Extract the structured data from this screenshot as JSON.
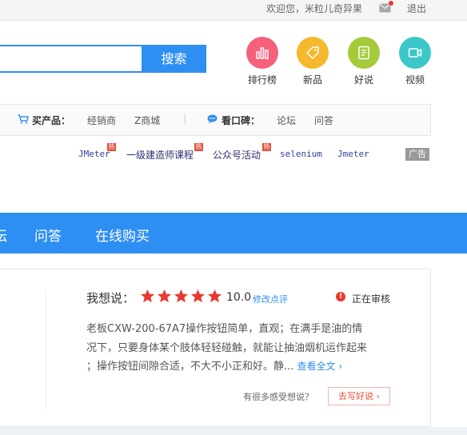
{
  "topbar": {
    "welcome": "欢迎您，米粒儿奇异果",
    "logout": "退出"
  },
  "search": {
    "value": "",
    "button": "搜索"
  },
  "nav_icons": [
    {
      "label": "排行榜",
      "icon": "bar-chart-icon",
      "color": "#f5617b"
    },
    {
      "label": "新品",
      "icon": "tag-icon",
      "color": "#f5b82e"
    },
    {
      "label": "好说",
      "icon": "note-icon",
      "color": "#a5cb3b"
    },
    {
      "label": "视频",
      "icon": "video-icon",
      "color": "#3cc8c8"
    }
  ],
  "products_bar": {
    "buy_label": "买产品：",
    "buy_links": [
      "经销商",
      "Z商城"
    ],
    "reputation_label": "看口碑：",
    "reputation_links": [
      "论坛",
      "问答"
    ]
  },
  "hot_keywords": [
    {
      "text": "JMeter",
      "hot": true
    },
    {
      "text": "一级建造师课程",
      "hot": true
    },
    {
      "text": "公众号活动",
      "hot": true
    },
    {
      "text": "selenium",
      "hot": false
    },
    {
      "text": "Jmeter",
      "hot": false
    }
  ],
  "hot_badge": "热",
  "ad_label": "广告",
  "main_nav": {
    "partial": "坛",
    "items": [
      "问答",
      "在线购买"
    ]
  },
  "review": {
    "label": "我想说：",
    "stars": 5,
    "score": "10.0",
    "edit_link": "修改点评",
    "status_icon": "!",
    "status": "正在审核",
    "lines": [
      "老板CXW-200-67A7操作按钮简单，直观；在满手是油的情",
      "况下，只要身体某个肢体轻轻碰触，就能让抽油烟机运作起来",
      "；操作按钮间隙合适，不大不小正和好。静..."
    ],
    "read_more": "查看全文",
    "question": "有很多感受想说？",
    "write_button": "去写好说"
  },
  "colors": {
    "accent": "#2e8ff2",
    "star": "#e8392f",
    "status": "#e8392f"
  }
}
